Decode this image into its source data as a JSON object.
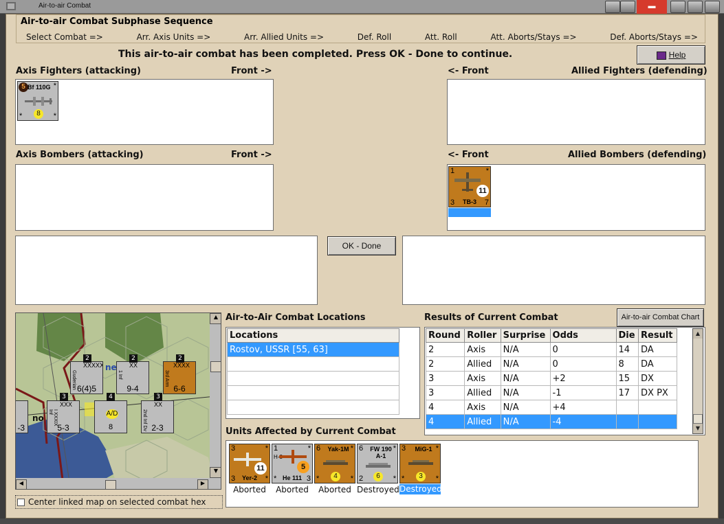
{
  "window": {
    "title": "Air-to-air Combat"
  },
  "sequence": {
    "title": "Air-to-air Combat Subphase Sequence",
    "steps": [
      "Select Combat =>",
      "Arr. Axis Units =>",
      "Arr. Allied Units =>",
      "Def. Roll",
      "Att. Roll",
      "Att. Aborts/Stays =>",
      "Def. Aborts/Stays =>"
    ]
  },
  "status_message": "This air-to-air combat has been completed.  Press OK - Done to continue.",
  "help_label": "Help",
  "panels": {
    "axis_fighters": {
      "title": "Axis Fighters (attacking)",
      "front": "Front ->"
    },
    "allied_fighters": {
      "front": "<- Front",
      "title": "Allied Fighters (defending)"
    },
    "axis_bombers": {
      "title": "Axis Bombers (attacking)",
      "front": "Front ->"
    },
    "allied_bombers": {
      "front": "<- Front",
      "title": "Allied Bombers (defending)"
    }
  },
  "units": {
    "axis_fighter": {
      "name": "Bf 110G",
      "top_left": "5",
      "top_right": "*",
      "bottom_left": "*",
      "bottom_right": "*",
      "value": "8"
    },
    "allied_bomber": {
      "name": "TB-3",
      "top_left": "1",
      "top_right": "*",
      "bottom_left": "3",
      "bottom_right": "7",
      "value": "11"
    }
  },
  "ok_done_label": "OK - Done",
  "map": {
    "counters": [
      {
        "top": "XXXXX",
        "name": "Guderian",
        "value": "6(4)5",
        "stack": "2"
      },
      {
        "top": "XX",
        "name": "1 Inf",
        "value": "9-4",
        "stack": "2"
      },
      {
        "top": "XXXX",
        "name": "3rd Arm",
        "value": "6-6",
        "stack": "2"
      },
      {
        "top": "XXX",
        "name": "I XXXIX Inf",
        "value": "5-3",
        "stack": "3"
      },
      {
        "top": "A/D",
        "name": "",
        "value": "8",
        "stack": "4"
      },
      {
        "top": "XX",
        "name": "2nd Inf Dv",
        "value": "2-3",
        "stack": "3"
      },
      {
        "top": "",
        "name": "",
        "value": "-3",
        "stack": ""
      }
    ],
    "labels": [
      "ne",
      "no"
    ]
  },
  "center_map_label": "Center linked map on selected combat hex",
  "locations": {
    "title": "Air-to-Air Combat Locations",
    "header": "Locations",
    "rows": [
      "Rostov, USSR [55, 63]"
    ]
  },
  "results": {
    "title": "Results of Current Combat",
    "chart_button": "Air-to-air Combat Chart",
    "columns": [
      "Round",
      "Roller",
      "Surprise",
      "Odds",
      "Die",
      "Result"
    ],
    "rows": [
      [
        "2",
        "Axis",
        "N/A",
        "0",
        "14",
        "DA"
      ],
      [
        "2",
        "Allied",
        "N/A",
        "0",
        "8",
        "DA"
      ],
      [
        "3",
        "Axis",
        "N/A",
        "+2",
        "15",
        "DX"
      ],
      [
        "3",
        "Allied",
        "N/A",
        "-1",
        "17",
        "DX PX"
      ],
      [
        "4",
        "Axis",
        "N/A",
        "+4",
        "",
        ""
      ],
      [
        "4",
        "Allied",
        "N/A",
        "-4",
        "",
        ""
      ]
    ]
  },
  "affected": {
    "title": "Units Affected by Current Combat",
    "units": [
      {
        "name": "Yer-2",
        "top_left": "3",
        "top_right": "*",
        "bottom_left": "3",
        "bottom_right": "*",
        "value": "11",
        "status": "Aborted",
        "color": "brown"
      },
      {
        "name": "He 111",
        "sub": "H-3",
        "top_left": "1",
        "top_right": "*",
        "bottom_left": "*",
        "bottom_right": "3",
        "value": "5",
        "status": "Aborted",
        "color": "grey"
      },
      {
        "name": "Yak-1M",
        "top_left": "6",
        "top_right": "*",
        "bottom_left": "*",
        "bottom_right": "*",
        "value": "4",
        "status": "Aborted",
        "color": "brown"
      },
      {
        "name": "FW 190",
        "sub": "A-1",
        "top_left": "6",
        "top_right": "*",
        "bottom_left": "2",
        "bottom_right": "*",
        "value": "6",
        "status": "Destroyed",
        "color": "grey"
      },
      {
        "name": "MiG-1",
        "top_left": "3",
        "top_right": "*",
        "bottom_left": "*",
        "bottom_right": "*",
        "value": "3",
        "status": "Destroyed",
        "color": "brown"
      }
    ]
  },
  "colors": {
    "background": "#e0d2b8",
    "selection": "#3399ff",
    "counter_brown": "#c07a1d",
    "counter_grey": "#bdbdbd"
  }
}
